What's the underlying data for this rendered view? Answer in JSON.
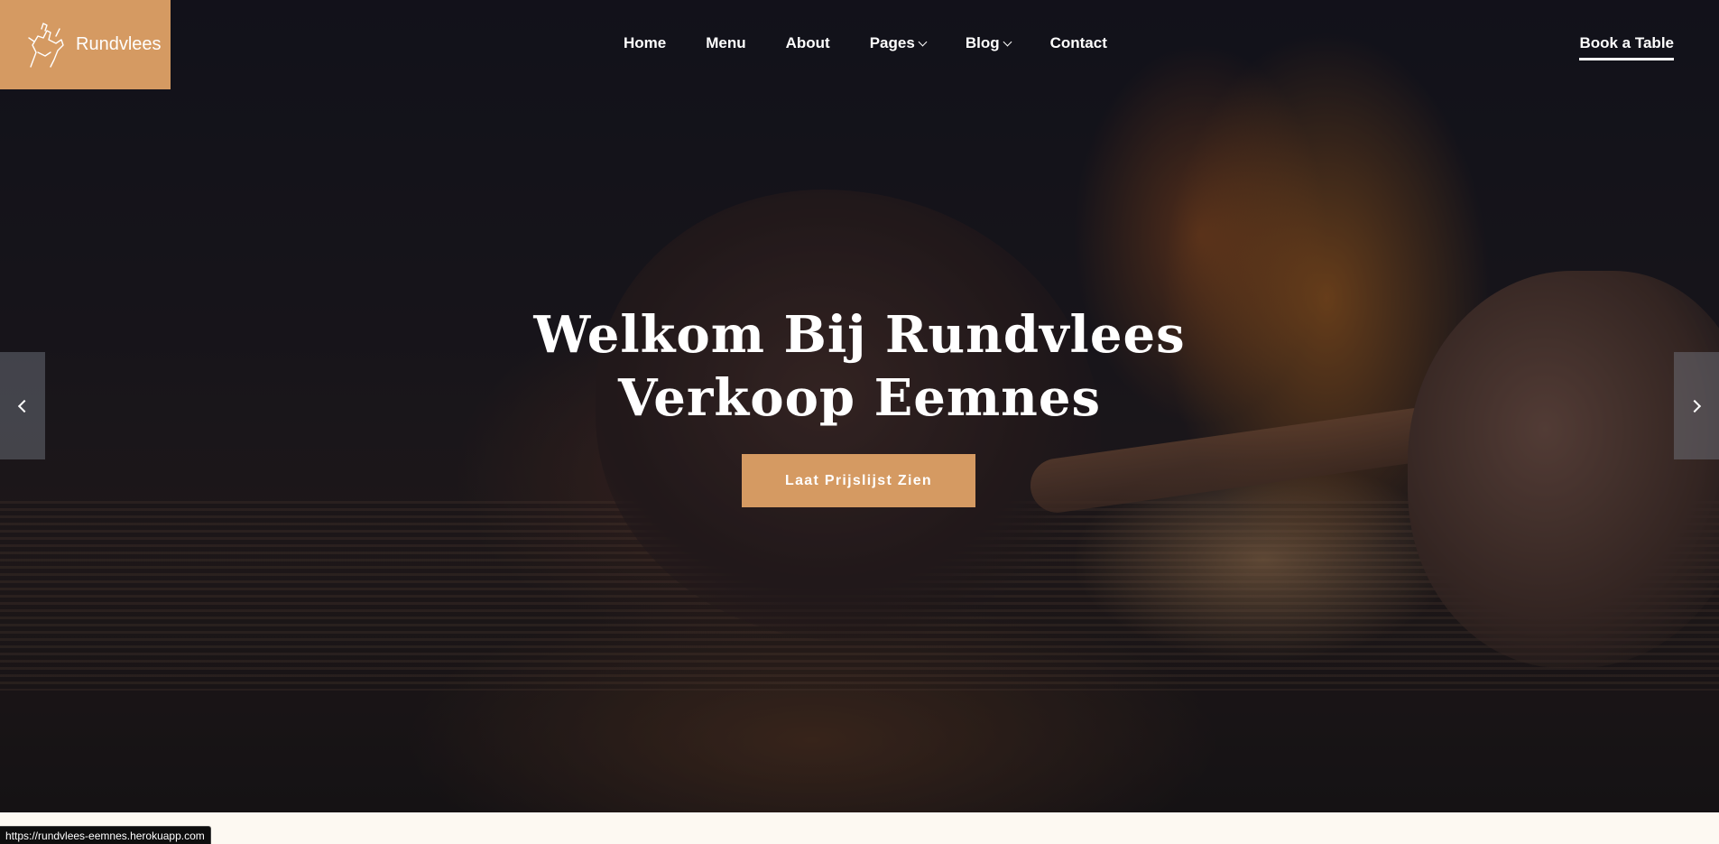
{
  "brand": {
    "name": "Rundvlees",
    "accent_color": "#d59a62",
    "logo_icon": "horse-rider-icon"
  },
  "nav": {
    "items": [
      {
        "label": "Home",
        "has_dropdown": false
      },
      {
        "label": "Menu",
        "has_dropdown": false
      },
      {
        "label": "About",
        "has_dropdown": false
      },
      {
        "label": "Pages",
        "has_dropdown": true
      },
      {
        "label": "Blog",
        "has_dropdown": true
      },
      {
        "label": "Contact",
        "has_dropdown": false
      }
    ],
    "book_label": "Book a Table"
  },
  "hero": {
    "title_line1": "Welkom Bij Rundvlees",
    "title_line2": "Verkoop Eemnes",
    "cta_label": "Laat Prijslijst Zien",
    "prev_icon": "chevron-left-icon",
    "next_icon": "chevron-right-icon"
  },
  "status_bar": {
    "url": "https://rundvlees-eemnes.herokuapp.com"
  }
}
